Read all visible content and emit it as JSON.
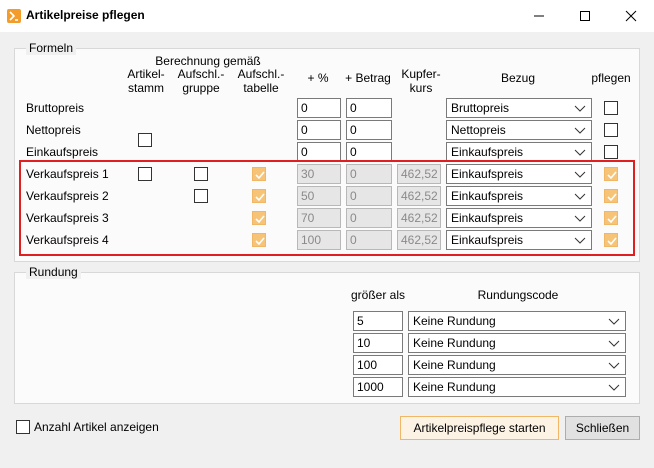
{
  "window": {
    "title": "Artikelpreise pflegen"
  },
  "formeln": {
    "legend": "Formeln",
    "berechnung_header": "Berechnung gemäß",
    "col_artikelstamm": [
      "Artikel-",
      "stamm"
    ],
    "col_aufschl_gruppe": [
      "Aufschl.-",
      "gruppe"
    ],
    "col_aufschl_tabelle": [
      "Aufschl.-",
      "tabelle"
    ],
    "col_prozent": "+ %",
    "col_betrag": "+ Betrag",
    "col_kupferkurs": [
      "Kupfer-",
      "kurs"
    ],
    "col_bezug": "Bezug",
    "col_pflegen": "pflegen",
    "rows": [
      {
        "name": "Bruttopreis",
        "prozent": "0",
        "betrag": "0",
        "kupferkurs": "",
        "bezug": "Bruttopreis",
        "artikelstamm": false,
        "gruppe": false,
        "tabelle": false,
        "pflegen": false
      },
      {
        "name": "Nettopreis",
        "prozent": "0",
        "betrag": "0",
        "kupferkurs": "",
        "bezug": "Nettopreis",
        "artikelstamm": false,
        "gruppe": false,
        "tabelle": false,
        "pflegen": false
      },
      {
        "name": "Einkaufspreis",
        "prozent": "0",
        "betrag": "0",
        "kupferkurs": "",
        "bezug": "Einkaufspreis",
        "artikelstamm": false,
        "gruppe": false,
        "tabelle": false,
        "pflegen": false
      },
      {
        "name": "Verkaufspreis 1",
        "prozent": "30",
        "betrag": "0",
        "kupferkurs": "462,52",
        "bezug": "Einkaufspreis",
        "artikelstamm": false,
        "gruppe": false,
        "tabelle": true,
        "pflegen": true
      },
      {
        "name": "Verkaufspreis 2",
        "prozent": "50",
        "betrag": "0",
        "kupferkurs": "462,52",
        "bezug": "Einkaufspreis",
        "artikelstamm": false,
        "gruppe": false,
        "tabelle": true,
        "pflegen": true
      },
      {
        "name": "Verkaufspreis 3",
        "prozent": "70",
        "betrag": "0",
        "kupferkurs": "462,52",
        "bezug": "Einkaufspreis",
        "artikelstamm": false,
        "gruppe": false,
        "tabelle": true,
        "pflegen": true
      },
      {
        "name": "Verkaufspreis 4",
        "prozent": "100",
        "betrag": "0",
        "kupferkurs": "462,52",
        "bezug": "Einkaufspreis",
        "artikelstamm": false,
        "gruppe": false,
        "tabelle": true,
        "pflegen": true
      }
    ]
  },
  "rundung": {
    "legend": "Rundung",
    "col_groesser": "größer als",
    "col_code": "Rundungscode",
    "rows": [
      {
        "groesser": "5",
        "code": "Keine Rundung"
      },
      {
        "groesser": "10",
        "code": "Keine Rundung"
      },
      {
        "groesser": "100",
        "code": "Keine Rundung"
      },
      {
        "groesser": "1000",
        "code": "Keine Rundung"
      }
    ]
  },
  "footer": {
    "anzahl_label": "Anzahl Artikel anzeigen",
    "start_button": "Artikelpreispflege starten",
    "close_button": "Schließen"
  },
  "colors": {
    "accent": "#f6c377",
    "highlight": "#e02020"
  }
}
